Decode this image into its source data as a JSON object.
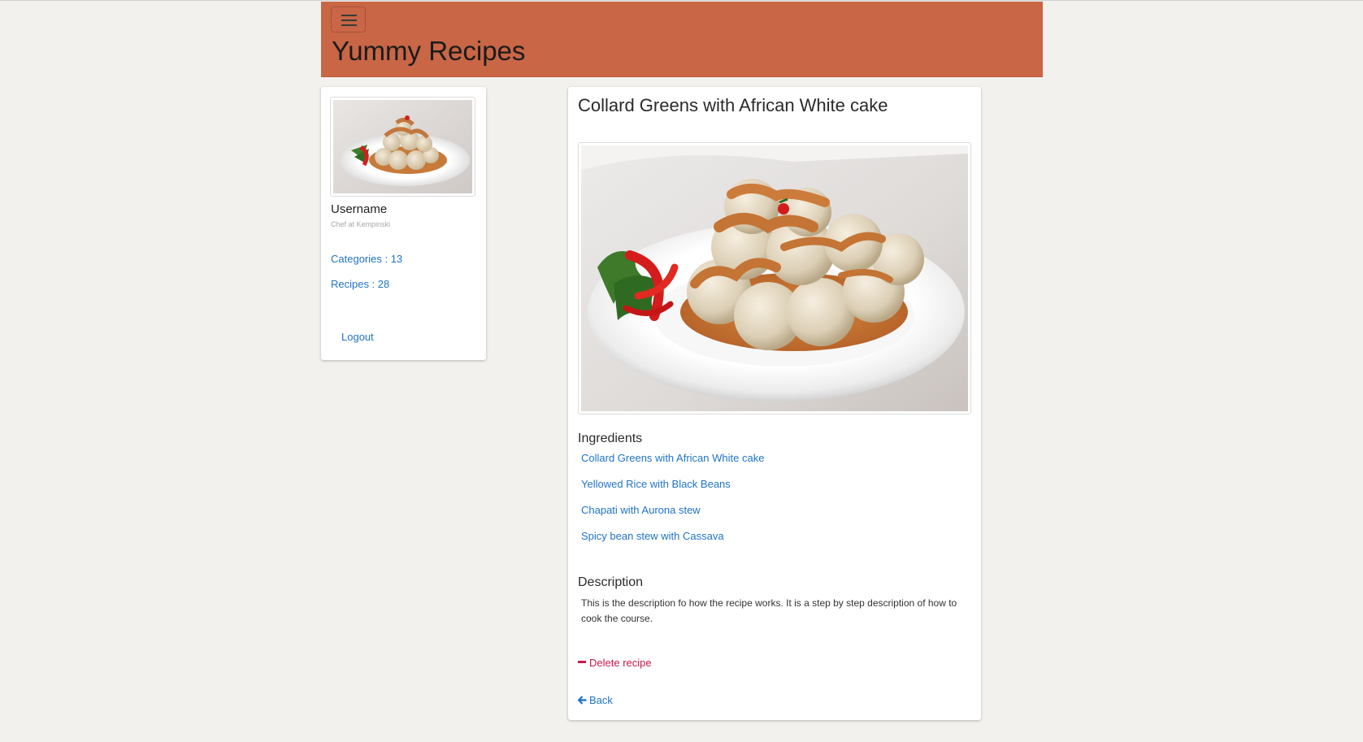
{
  "app": {
    "title": "Yummy Recipes",
    "brand_color": "#c86646",
    "menu_icon": "hamburger-menu-icon"
  },
  "profile": {
    "avatar_image": "dumplings-photo",
    "username": "Username",
    "title": "Chef at Kempinski",
    "categories_label": "Categories : 13",
    "recipes_label": "Recipes : 28",
    "logout_label": "Logout"
  },
  "recipe": {
    "title": "Collard Greens with African White cake",
    "image": "dumplings-photo",
    "ingredients_heading": "Ingredients",
    "ingredients": [
      "Collard Greens with African White cake",
      "Yellowed Rice with Black Beans",
      "Chapati with Aurona stew",
      "Spicy bean stew with Cassava"
    ],
    "description_heading": "Description",
    "description": "This is the description fo how the recipe works. It is a step by step description of how to cook the course.",
    "delete_label": "Delete recipe",
    "delete_icon": "minus-icon",
    "delete_color": "#c9184a",
    "back_label": "Back",
    "back_icon": "arrow-left-icon",
    "link_color": "#1f73c9"
  }
}
